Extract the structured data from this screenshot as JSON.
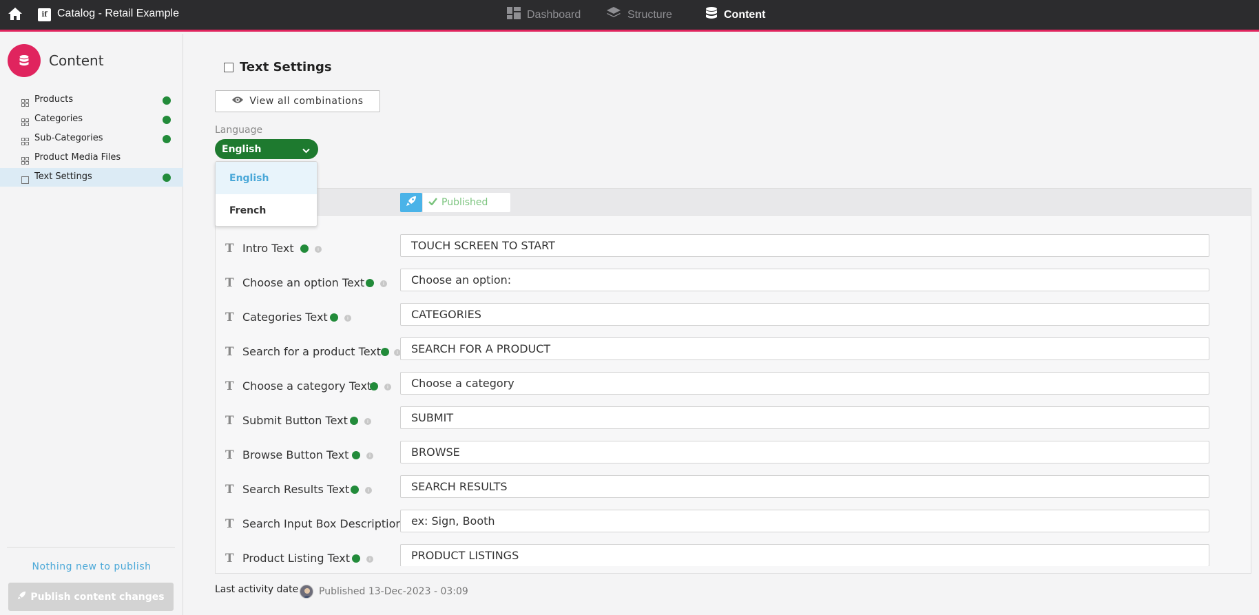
{
  "app": {
    "title": "Catalog - Retail Example",
    "logo_text": "if"
  },
  "topnav": [
    {
      "label": "Dashboard",
      "icon": "dashboard-icon",
      "active": false
    },
    {
      "label": "Structure",
      "icon": "layers-icon",
      "active": false
    },
    {
      "label": "Content",
      "icon": "database-icon",
      "active": true
    }
  ],
  "sidebar": {
    "title": "Content",
    "items": [
      {
        "label": "Products",
        "icon": "grid-icon",
        "status": "green"
      },
      {
        "label": "Categories",
        "icon": "grid-icon",
        "status": "green"
      },
      {
        "label": "Sub-Categories",
        "icon": "grid-icon",
        "status": "green"
      },
      {
        "label": "Product Media Files",
        "icon": "grid-icon",
        "status": null
      },
      {
        "label": "Text Settings",
        "icon": "square-icon",
        "status": "green",
        "selected": true
      }
    ],
    "nothing_new": "Nothing new to publish",
    "publish_label": "Publish content changes"
  },
  "main": {
    "heading": "Text Settings",
    "view_all_label": "View all combinations",
    "language_label": "Language",
    "language_selected": "English",
    "language_options": [
      "English",
      "French"
    ],
    "status": "Published",
    "fields": [
      {
        "label": "Intro Text",
        "value": "TOUCH SCREEN TO START",
        "status": "green"
      },
      {
        "label": "Choose an option Text",
        "value": "Choose an option:",
        "status": "green"
      },
      {
        "label": "Categories Text",
        "value": "CATEGORIES",
        "status": "green"
      },
      {
        "label": "Search for a product Text",
        "value": "SEARCH FOR A PRODUCT",
        "status": "green"
      },
      {
        "label": "Choose a category Text",
        "value": "Choose a category",
        "status": "green"
      },
      {
        "label": "Submit Button Text",
        "value": "SUBMIT",
        "status": "green"
      },
      {
        "label": "Browse Button Text",
        "value": "BROWSE",
        "status": "green"
      },
      {
        "label": "Search Results Text",
        "value": "SEARCH RESULTS",
        "status": "green"
      },
      {
        "label": "Search Input Box Description",
        "value": "ex: Sign, Booth",
        "status": null
      },
      {
        "label": "Product Listing Text",
        "value": "PRODUCT LISTINGS",
        "status": "green"
      }
    ],
    "last_activity_label": "Last activity date",
    "last_activity_value": "Published 13-Dec-2023 - 03:09"
  },
  "colors": {
    "accent": "#e0245e",
    "status_green": "#228b3a",
    "info_blue": "#4aa8d8",
    "lang_green": "#1e7a2f"
  }
}
